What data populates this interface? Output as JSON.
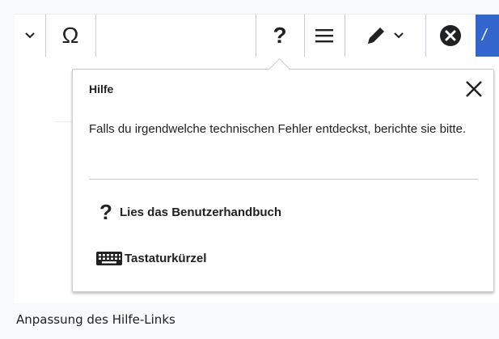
{
  "toolbar": {
    "special_char_label": "Ω",
    "help_label": "?",
    "colors": {
      "accent": "#3366cc",
      "border": "#c8ccd1",
      "text": "#202122"
    }
  },
  "popup": {
    "title": "Hilfe",
    "text": "Falls du irgendwelche technischen Fehler entdeckst, berichte sie bitte.",
    "links": [
      {
        "icon": "question-mark-icon",
        "label": "Lies das Benutzerhandbuch"
      },
      {
        "icon": "keyboard-icon",
        "label": "Tastaturkürzel"
      }
    ]
  },
  "caption": "Anpassung des Hilfe-Links"
}
